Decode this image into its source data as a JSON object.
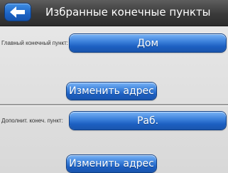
{
  "header": {
    "back_icon": "arrow-left-icon",
    "title": "Избранные конечные пункты"
  },
  "main_destination": {
    "label": "Главный конечный пункт:",
    "value": "Дом",
    "change_button": "Изменить адрес"
  },
  "extra_destination": {
    "label": "Дополнит. конеч. пункт:",
    "value": "Раб.",
    "change_button": "Изменить адрес"
  },
  "colors": {
    "button_blue": "#1c5fc1",
    "titlebar_dark": "#3a3a3a",
    "background": "#e3e3e3"
  }
}
